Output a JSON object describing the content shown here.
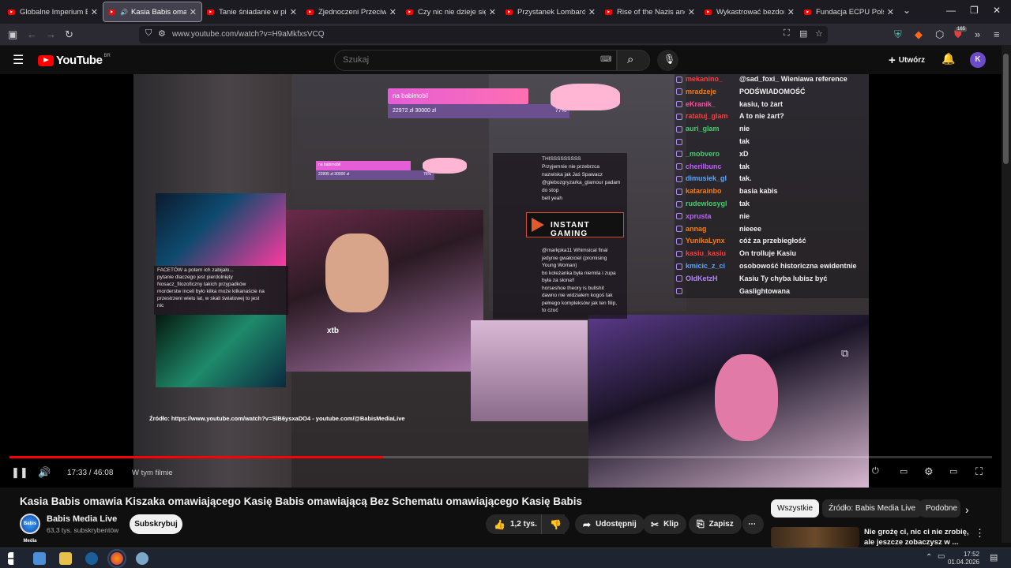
{
  "browser": {
    "tabs": [
      {
        "label": "Globalne Imperium Bezk",
        "active": false
      },
      {
        "label": "Kasia Babis omawia K",
        "active": true,
        "audio": true
      },
      {
        "label": "Tanie śniadanie w piekar",
        "active": false
      },
      {
        "label": "Zjednoczeni Przeciw Ras",
        "active": false
      },
      {
        "label": "Czy nic nie dzieje się prz",
        "active": false
      },
      {
        "label": "Przystanek Lombard - Os",
        "active": false
      },
      {
        "label": "Rise of the Nazis and Ad",
        "active": false
      },
      {
        "label": "Wykastrować bezdomno",
        "active": false
      },
      {
        "label": "Fundacja ECPU Polska: k",
        "active": false
      }
    ],
    "url": "www.youtube.com/watch?v=H9aMkfxsVCQ",
    "extension_badge": "165"
  },
  "youtube": {
    "logo_text": "YouTube",
    "logo_country": "BR",
    "search_placeholder": "Szukaj",
    "create_label": "Utwórz",
    "avatar_letter": "K"
  },
  "video_overlay": {
    "donation_goal_label": "na babimobil",
    "donation_goal_values": "22972 zł 30000 zł",
    "donation_goal_percent": "77%",
    "donation_goal_small_label": "na babimobil",
    "donation_goal_small_values": "22895 zł 30000 zł",
    "donation_goal_small_percent": "76%",
    "sponsor": "INSTANT GAMING",
    "xtb": "xtb",
    "source_caption": "Źródło: https://www.youtube.com/watch?v=SlB6ysxaDO4 - youtube.com/@BabisMediaLive",
    "left_chat": [
      "FACETÓW a potem ich zabijało...",
      "pytanie dlaczego jest pierdolnięty",
      "Nosacz_filozoficzny takich przypadków",
      "morderstw inceli było kilka może kilkanaście na",
      "przestrzeni wielu lat, w skali światowej to jest",
      "nic"
    ],
    "mid_chat": [
      "THISSSSSSSSS",
      "Przyjemnie nie przebrzca",
      "nazwiska jak Jaś Spawacz",
      "@glebozgryzarka_glamour padam",
      "do stop",
      "bell yeah",
      "@markpka11 Whimsical final",
      "jedynie gwałciciel (promising",
      "Young Woman)",
      "bo koleżanka była niemila i zupa",
      "była za słona!!",
      "horseshoe theory is bullshit",
      "dawno nie widziałem kogoś tak",
      "pełnego kompleksów jak ten filip,",
      "to czuć"
    ],
    "right_chat": [
      {
        "user": "mekanino_",
        "msg": "@sad_foxi_ Wieniawa reference",
        "color": "#ff3b3b"
      },
      {
        "user": "mradzeje",
        "msg": "PODŚWIADOMOŚĆ",
        "color": "#ff7a00"
      },
      {
        "user": "eKranik_",
        "msg": "kasiu, to żart",
        "color": "#ff4fa3"
      },
      {
        "user": "ratatuj_glam",
        "msg": "A to nie żart?",
        "color": "#ff3b3b"
      },
      {
        "user": "auri_glam",
        "msg": "nie",
        "color": "#3fd16b"
      },
      {
        "user": "",
        "msg": "tak",
        "color": "#b388ff"
      },
      {
        "user": "_mobvero",
        "msg": "xD",
        "color": "#3fd16b"
      },
      {
        "user": "cherilbunc",
        "msg": "tak",
        "color": "#c060ff"
      },
      {
        "user": "dimusiek_gl",
        "msg": "tak.",
        "color": "#5aa9ff"
      },
      {
        "user": "katarainbo",
        "msg": "basia kabis",
        "color": "#ff7a00"
      },
      {
        "user": "rudewlosygl",
        "msg": "tak",
        "color": "#3fd16b"
      },
      {
        "user": "xprusta",
        "msg": "nie",
        "color": "#c060ff"
      },
      {
        "user": "annag",
        "msg": "nieeee",
        "color": "#ff7a00"
      },
      {
        "user": "YunikaLynx",
        "msg": "cóż za przebiegłość",
        "color": "#ff7a00"
      },
      {
        "user": "kasiu_kasiu",
        "msg": "On trolluje Kasiu",
        "color": "#ff3b3b"
      },
      {
        "user": "kmicic_z_ci",
        "msg": "osobowość historiczna ewidentnie",
        "color": "#5aa9ff"
      },
      {
        "user": "OldKetzH",
        "msg": "Kasiu Ty chyba lubisz być",
        "color": "#b388ff"
      },
      {
        "user": "",
        "msg": "Gaslightowana",
        "color": "#ffffff"
      }
    ]
  },
  "player": {
    "time_current": "17:33",
    "time_total": "46:08",
    "time_display": "17:33 / 46:08",
    "chapter_label": "W tym filmie",
    "progress_fraction": 0.38,
    "buffer_fraction": 0.38
  },
  "video": {
    "title": "Kasia Babis omawia Kiszaka omawiającego Kasię Babis omawiającą Bez Schematu omawiającego Kasię Babis",
    "channel_name": "Babis Media Live",
    "channel_subs": "63,3 tys. subskrybentów",
    "channel_avatar_text": "Babis Media",
    "subscribe_label": "Subskrybuj",
    "likes": "1,2 tys.",
    "share_label": "Udostępnij",
    "clip_label": "Klip",
    "save_label": "Zapisz"
  },
  "sidebar": {
    "chips": [
      "Wszystkie",
      "Źródło: Babis Media Live",
      "Podobne"
    ],
    "recommended_title": "Nie grożę ci, nic ci nie zrobię, ale jeszcze zobaczysz w ..."
  },
  "taskbar": {
    "time": "17:52",
    "date": "01.04.2026"
  },
  "colors": {
    "yt_red": "#ff0000",
    "accent_purple": "#6b4cc8",
    "background": "#0f0f0f"
  }
}
